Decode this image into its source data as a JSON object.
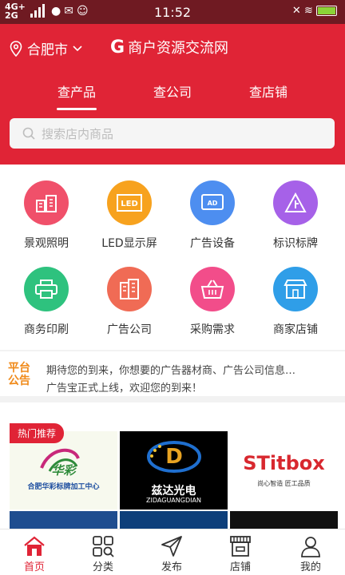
{
  "status_bar": {
    "network_top": "4G+",
    "network_bottom": "2G",
    "time": "11:52",
    "icons": [
      "message-icon",
      "mail-icon",
      "qq-icon",
      "silent-icon",
      "wifi-icon",
      "battery-icon"
    ]
  },
  "header": {
    "city": "合肥市",
    "brand_logo": "G",
    "brand_name": "商户资源交流网",
    "tabs": [
      {
        "label": "查产品",
        "active": true
      },
      {
        "label": "查公司",
        "active": false
      },
      {
        "label": "查店铺",
        "active": false
      }
    ],
    "search_placeholder": "搜索店内商品"
  },
  "categories": [
    {
      "label": "景观照明",
      "icon": "building-icon",
      "color": "#f0506a"
    },
    {
      "label": "LED显示屏",
      "icon": "led-icon",
      "color": "#f7a21e"
    },
    {
      "label": "广告设备",
      "icon": "ad-icon",
      "color": "#4d8ef0"
    },
    {
      "label": "标识标牌",
      "icon": "sign-icon",
      "color": "#a661e8"
    },
    {
      "label": "商务印刷",
      "icon": "printer-icon",
      "color": "#2ec27e"
    },
    {
      "label": "广告公司",
      "icon": "office-building-icon",
      "color": "#f06b55"
    },
    {
      "label": "采购需求",
      "icon": "basket-icon",
      "color": "#f24d8a"
    },
    {
      "label": "商家店铺",
      "icon": "store-icon",
      "color": "#2f9ee8"
    }
  ],
  "notice": {
    "logo_line1": "平台",
    "logo_line2": "公告",
    "line1": "期待您的到来，你想要的广告器材商、广告公司信息…",
    "line2": "广告宝正式上线，欢迎您的到来！"
  },
  "hot": {
    "badge": "热门推荐",
    "products": [
      {
        "title": "合肥华彩标牌加工中心",
        "sub": "华彩"
      },
      {
        "title": "兹达光电",
        "sub": "ZIDAGUANGDIAN"
      },
      {
        "title": "STitbox",
        "sub": "尚心智造 匠工品质"
      }
    ]
  },
  "bottom_nav": [
    {
      "label": "首页",
      "icon": "home-icon",
      "active": true
    },
    {
      "label": "分类",
      "icon": "category-icon",
      "active": false
    },
    {
      "label": "发布",
      "icon": "send-icon",
      "active": false
    },
    {
      "label": "店铺",
      "icon": "shop-icon",
      "active": false
    },
    {
      "label": "我的",
      "icon": "user-icon",
      "active": false
    }
  ]
}
